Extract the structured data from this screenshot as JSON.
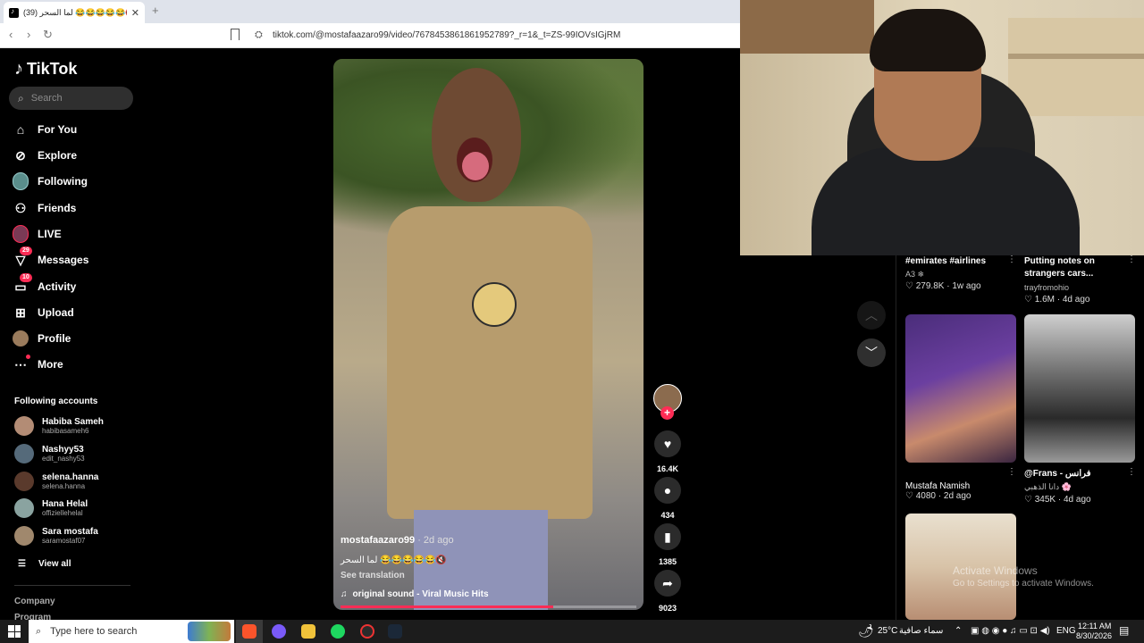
{
  "browser": {
    "tab_title": "(39) لما السحر 😂😂😂😂😂🔇",
    "tab_close": "✕",
    "new_tab": "+",
    "back": "‹",
    "forward": "›",
    "reload": "↻",
    "site_info_icon": "⛭",
    "url": "tiktok.com/@mostafaazaro99/video/7678453861861952789?_r=1&_t=ZS-99IOVsIGjRM"
  },
  "sidebar": {
    "logo": "TikTok",
    "search_placeholder": "Search",
    "nav": [
      {
        "label": "For You",
        "icon": "⌂"
      },
      {
        "label": "Explore",
        "icon": "⊘"
      },
      {
        "label": "Following",
        "icon": ""
      },
      {
        "label": "Friends",
        "icon": "⚇"
      },
      {
        "label": "LIVE",
        "icon": ""
      },
      {
        "label": "Messages",
        "icon": "▽",
        "badge": "29"
      },
      {
        "label": "Activity",
        "icon": "▭",
        "badge": "10"
      },
      {
        "label": "Upload",
        "icon": "⊞"
      },
      {
        "label": "Profile",
        "icon": ""
      },
      {
        "label": "More",
        "icon": "⋯"
      }
    ],
    "following_heading": "Following accounts",
    "accounts": [
      {
        "name": "Habiba Sameh",
        "handle": "habibasameh6"
      },
      {
        "name": "Nashyy53",
        "handle": "edit_nashy53"
      },
      {
        "name": "selena.hanna",
        "handle": "selena.hanna"
      },
      {
        "name": "Hana Helal",
        "handle": "offiziellehelal"
      },
      {
        "name": "Sara mostafa",
        "handle": "saramostaf07"
      }
    ],
    "view_all": "View all",
    "view_all_icon": "☰",
    "company": "Company",
    "program": "Program"
  },
  "video": {
    "author": "mostafaazaro99",
    "ago": " · 2d ago",
    "caption": "لما السحر 😂😂😂😂😂🔇",
    "translate": "See translation",
    "sound": "original sound - Viral Music Hits",
    "sound_icon": "♫",
    "progress": 0.72,
    "likes": "16.4K",
    "comments": "434",
    "saves": "1385",
    "shares": "9023"
  },
  "feed": {
    "items": [
      {
        "title": "#emirates #airlines",
        "author": "A3 ❄",
        "likes": "279.8K",
        "ago": "1w ago"
      },
      {
        "title": "Putting notes on strangers cars...",
        "author": "trayfromohio",
        "likes": "1.6M",
        "ago": "4d ago"
      },
      {
        "title": "Mustafa Namish",
        "author": "",
        "likes": "4080",
        "ago": "2d ago"
      },
      {
        "title": "@Frans - فرانس",
        "author": "دانا الذهبي 🌸",
        "likes": "345K",
        "ago": "4d ago"
      }
    ],
    "heart": "♡",
    "kebab": "⋮"
  },
  "watermark": {
    "line1": "Activate Windows",
    "line2": "Go to Settings to activate Windows."
  },
  "taskbar": {
    "search_placeholder": "Type here to search",
    "weather": "25°C",
    "weather_text": "سماء صافية",
    "lang": "ENG",
    "time": "12:11 AM",
    "date": "8/30/2026",
    "up_icon": "⌃"
  }
}
